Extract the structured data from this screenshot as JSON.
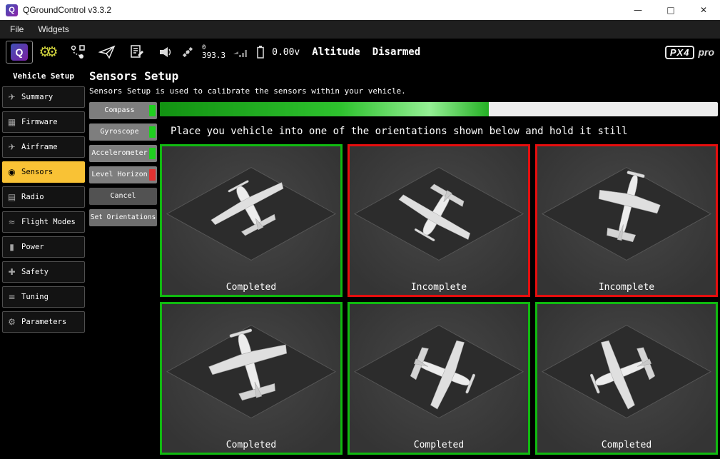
{
  "window": {
    "title": "QGroundControl v3.3.2",
    "logo": "Q",
    "minimize": "—",
    "maximize": "□",
    "close": "✕"
  },
  "menu": {
    "file": "File",
    "widgets": "Widgets"
  },
  "toolbar": {
    "logo": "Q",
    "gears": "⚙⚙",
    "sat_count": "0",
    "sat_value": "393.3",
    "battery_voltage": "0.00v",
    "flight_mode": "Altitude",
    "armed_state": "Disarmed",
    "brand_px4": "PX4",
    "brand_pro": "pro"
  },
  "sidebar": {
    "title": "Vehicle Setup",
    "items": [
      {
        "icon": "✈",
        "label": "Summary"
      },
      {
        "icon": "▦",
        "label": "Firmware"
      },
      {
        "icon": "✈",
        "label": "Airframe"
      },
      {
        "icon": "◉",
        "label": "Sensors",
        "active": true
      },
      {
        "icon": "▤",
        "label": "Radio"
      },
      {
        "icon": "≈",
        "label": "Flight Modes"
      },
      {
        "icon": "▮",
        "label": "Power"
      },
      {
        "icon": "✚",
        "label": "Safety"
      },
      {
        "icon": "≡",
        "label": "Tuning"
      },
      {
        "icon": "⚙",
        "label": "Parameters"
      }
    ]
  },
  "main": {
    "title": "Sensors Setup",
    "description": "Sensors Setup is used to calibrate the sensors within your vehicle.",
    "sensor_buttons": [
      {
        "label": "Compass",
        "status_color": "#1fd01f"
      },
      {
        "label": "Gyroscope",
        "status_color": "#1fd01f"
      },
      {
        "label": "Accelerometer",
        "status_color": "#1fd01f"
      },
      {
        "label": "Level Horizon",
        "status_color": "#e03131"
      },
      {
        "label": "Cancel"
      },
      {
        "label": "Set Orientations"
      }
    ],
    "progress_percent": 59,
    "instruction": "Place you vehicle into one of the orientations shown below and hold it still",
    "orientations": [
      {
        "label": "Completed",
        "state": "completed"
      },
      {
        "label": "Incomplete",
        "state": "incomplete"
      },
      {
        "label": "Incomplete",
        "state": "incomplete"
      },
      {
        "label": "Completed",
        "state": "completed"
      },
      {
        "label": "Completed",
        "state": "completed"
      },
      {
        "label": "Completed",
        "state": "completed"
      }
    ]
  },
  "colors": {
    "completed_border": "#10ba10",
    "incomplete_border": "#e60e0e",
    "active_sidebar": "#f9c235"
  }
}
